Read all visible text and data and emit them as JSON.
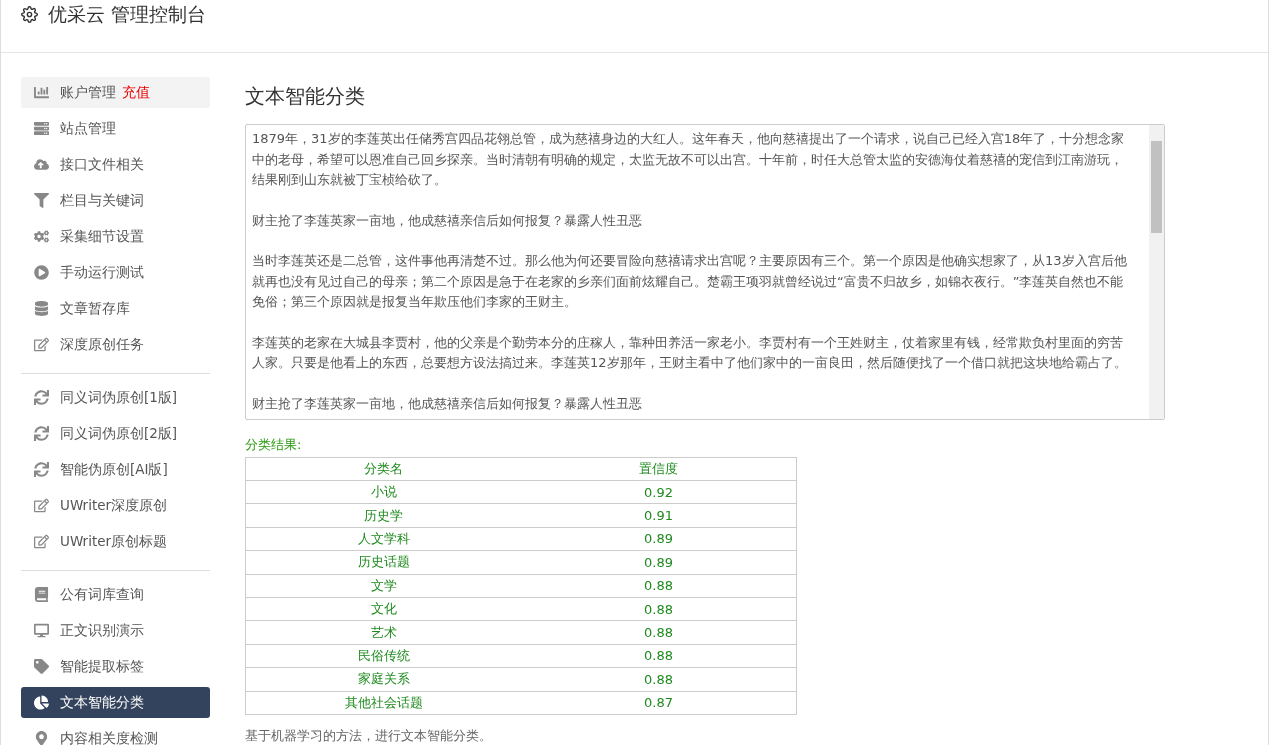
{
  "header": {
    "title": "优采云 管理控制台"
  },
  "sidebar": {
    "groups": [
      {
        "items": [
          {
            "label": "账户管理",
            "badge": "充值",
            "highlighted": true,
            "selected": false
          },
          {
            "label": "站点管理",
            "highlighted": false,
            "selected": false
          },
          {
            "label": "接口文件相关",
            "highlighted": false,
            "selected": false
          },
          {
            "label": "栏目与关键词",
            "highlighted": false,
            "selected": false
          },
          {
            "label": "采集细节设置",
            "highlighted": false,
            "selected": false
          },
          {
            "label": "手动运行测试",
            "highlighted": false,
            "selected": false
          },
          {
            "label": "文章暂存库",
            "highlighted": false,
            "selected": false
          },
          {
            "label": "深度原创任务",
            "highlighted": false,
            "selected": false
          }
        ]
      },
      {
        "items": [
          {
            "label": "同义词伪原创[1版]",
            "highlighted": false,
            "selected": false
          },
          {
            "label": "同义词伪原创[2版]",
            "highlighted": false,
            "selected": false
          },
          {
            "label": "智能伪原创[AI版]",
            "highlighted": false,
            "selected": false
          },
          {
            "label": "UWriter深度原创",
            "highlighted": false,
            "selected": false
          },
          {
            "label": "UWriter原创标题",
            "highlighted": false,
            "selected": false
          }
        ]
      },
      {
        "items": [
          {
            "label": "公有词库查询",
            "highlighted": false,
            "selected": false
          },
          {
            "label": "正文识别演示",
            "highlighted": false,
            "selected": false
          },
          {
            "label": "智能提取标签",
            "highlighted": false,
            "selected": false
          },
          {
            "label": "文本智能分类",
            "highlighted": false,
            "selected": true
          },
          {
            "label": "内容相关度检测",
            "highlighted": false,
            "selected": false
          }
        ]
      }
    ]
  },
  "main": {
    "title": "文本智能分类",
    "text_input": {
      "paragraphs": [
        "1879年，31岁的李莲英出任储秀宫四品花翎总管，成为慈禧身边的大红人。这年春天，他向慈禧提出了一个请求，说自己已经入宫18年了，十分想念家中的老母，希望可以恩准自己回乡探亲。当时清朝有明确的规定，太监无故不可以出宫。十年前，时任大总管太监的安德海仗着慈禧的宠信到江南游玩，结果刚到山东就被丁宝桢给砍了。",
        "财主抢了李莲英家一亩地，他成慈禧亲信后如何报复？暴露人性丑恶",
        "当时李莲英还是二总管，这件事他再清楚不过。那么他为何还要冒险向慈禧请求出宫呢？主要原因有三个。第一个原因是他确实想家了，从13岁入宫后他就再也没有见过自己的母亲；第二个原因是急于在老家的乡亲们面前炫耀自己。楚霸王项羽就曾经说过“富贵不归故乡，如锦衣夜行。”李莲英自然也不能免俗；第三个原因就是报复当年欺压他们李家的王财主。",
        "李莲英的老家在大城县李贾村，他的父亲是个勤劳本分的庄稼人，靠种田养活一家老小。李贾村有一个王姓财主，仗着家里有钱，经常欺负村里面的穷苦人家。只要是他看上的东西，总要想方设法搞过来。李莲英12岁那年，王财主看中了他们家中的一亩良田，然后随便找了一个借口就把这块地给霸占了。",
        "财主抢了李莲英家一亩地，他成慈禧亲信后如何报复？暴露人性丑恶"
      ]
    },
    "result_label": "分类结果:",
    "table": {
      "columns": [
        "分类名",
        "置信度"
      ],
      "rows": [
        [
          "小说",
          "0.92"
        ],
        [
          "历史学",
          "0.91"
        ],
        [
          "人文学科",
          "0.89"
        ],
        [
          "历史话题",
          "0.89"
        ],
        [
          "文学",
          "0.88"
        ],
        [
          "文化",
          "0.88"
        ],
        [
          "艺术",
          "0.88"
        ],
        [
          "民俗传统",
          "0.88"
        ],
        [
          "家庭关系",
          "0.88"
        ],
        [
          "其他社会话题",
          "0.87"
        ]
      ]
    },
    "note": "基于机器学习的方法，进行文本智能分类。"
  }
}
